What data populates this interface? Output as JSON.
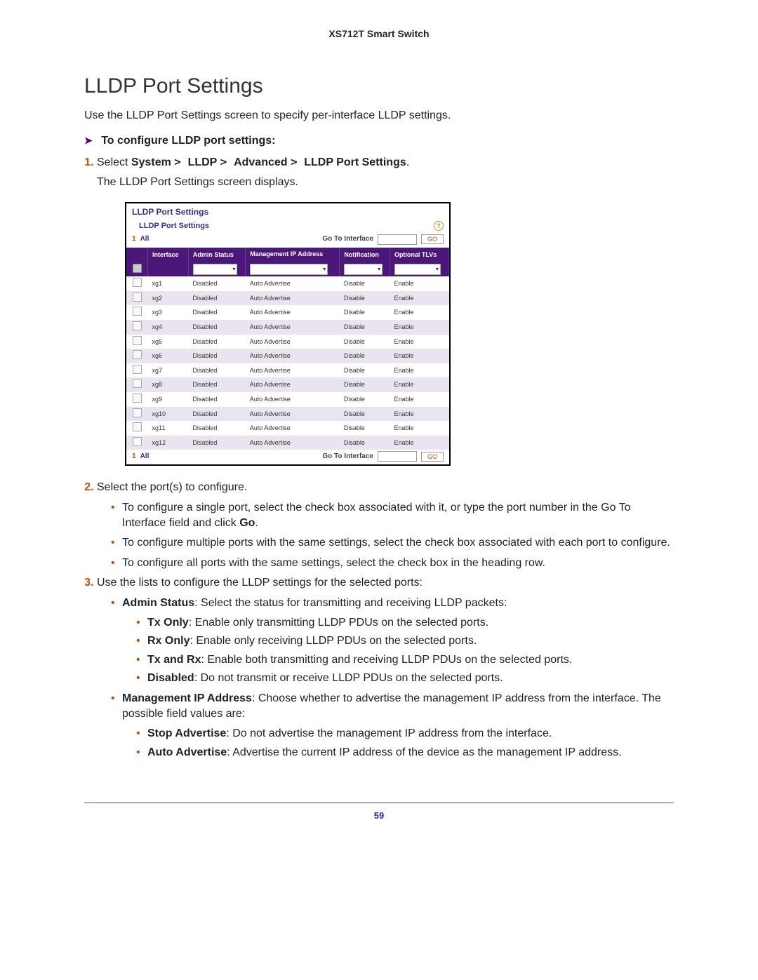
{
  "device_title": "XS712T Smart Switch",
  "heading": "LLDP Port Settings",
  "intro": "Use the LLDP Port Settings screen to specify per-interface LLDP settings.",
  "proc_title": "To configure LLDP port settings:",
  "step1_prefix": "Select ",
  "breadcrumb": {
    "a": "System",
    "b": "LLDP",
    "c": "Advanced",
    "d": "LLDP Port Settings"
  },
  "step1_suffix": ".",
  "step1_line2": "The LLDP Port Settings screen displays.",
  "shot": {
    "panel_title": "LLDP Port Settings",
    "sub_title": "LLDP Port Settings",
    "nav": {
      "one": "1",
      "all": "All",
      "gti_label": "Go To Interface",
      "go": "GO",
      "input": ""
    },
    "columns": [
      "",
      "Interface",
      "Admin Status",
      "Management IP Address",
      "Notification",
      "Optional TLVs"
    ],
    "rows": [
      {
        "iface": "xg1",
        "admin": "Disabled",
        "mip": "Auto Advertise",
        "notif": "Disable",
        "tlv": "Enable"
      },
      {
        "iface": "xg2",
        "admin": "Disabled",
        "mip": "Auto Advertise",
        "notif": "Disable",
        "tlv": "Enable"
      },
      {
        "iface": "xg3",
        "admin": "Disabled",
        "mip": "Auto Advertise",
        "notif": "Disable",
        "tlv": "Enable"
      },
      {
        "iface": "xg4",
        "admin": "Disabled",
        "mip": "Auto Advertise",
        "notif": "Disable",
        "tlv": "Enable"
      },
      {
        "iface": "xg5",
        "admin": "Disabled",
        "mip": "Auto Advertise",
        "notif": "Disable",
        "tlv": "Enable"
      },
      {
        "iface": "xg6",
        "admin": "Disabled",
        "mip": "Auto Advertise",
        "notif": "Disable",
        "tlv": "Enable"
      },
      {
        "iface": "xg7",
        "admin": "Disabled",
        "mip": "Auto Advertise",
        "notif": "Disable",
        "tlv": "Enable"
      },
      {
        "iface": "xg8",
        "admin": "Disabled",
        "mip": "Auto Advertise",
        "notif": "Disable",
        "tlv": "Enable"
      },
      {
        "iface": "xg9",
        "admin": "Disabled",
        "mip": "Auto Advertise",
        "notif": "Disable",
        "tlv": "Enable"
      },
      {
        "iface": "xg10",
        "admin": "Disabled",
        "mip": "Auto Advertise",
        "notif": "Disable",
        "tlv": "Enable"
      },
      {
        "iface": "xg11",
        "admin": "Disabled",
        "mip": "Auto Advertise",
        "notif": "Disable",
        "tlv": "Enable"
      },
      {
        "iface": "xg12",
        "admin": "Disabled",
        "mip": "Auto Advertise",
        "notif": "Disable",
        "tlv": "Enable"
      }
    ]
  },
  "step2": "Select the port(s) to configure.",
  "step2_bullets": [
    {
      "pre": "To configure a single port, select the check box associated with it, or type the port number in the Go To Interface field and click ",
      "bold": "Go",
      "post": "."
    },
    {
      "pre": "To configure multiple ports with the same settings, select the check box associated with each port to configure.",
      "bold": "",
      "post": ""
    },
    {
      "pre": "To configure all ports with the same settings, select the check box in the heading row.",
      "bold": "",
      "post": ""
    }
  ],
  "step3": "Use the lists to configure the LLDP settings for the selected ports:",
  "step3_main": [
    {
      "lead_bold": "Admin Status",
      "lead_rest": ": Select the status for transmitting and receiving LLDP packets:",
      "subs": [
        {
          "b": "Tx Only",
          "t": ": Enable only transmitting LLDP PDUs on the selected ports."
        },
        {
          "b": "Rx Only",
          "t": ": Enable only receiving LLDP PDUs on the selected ports."
        },
        {
          "b": "Tx and Rx",
          "t": ": Enable both transmitting and receiving LLDP PDUs on the selected ports."
        },
        {
          "b": "Disabled",
          "t": ": Do not transmit or receive LLDP PDUs on the selected ports."
        }
      ]
    },
    {
      "lead_bold": "Management IP Address",
      "lead_rest": ": Choose whether to advertise the management IP address from the interface. The possible field values are:",
      "subs": [
        {
          "b": "Stop Advertise",
          "t": ": Do not advertise the management IP address from the interface."
        },
        {
          "b": "Auto Advertise",
          "t": ": Advertise the current IP address of the device as the management IP address."
        }
      ]
    }
  ],
  "page_number": "59"
}
